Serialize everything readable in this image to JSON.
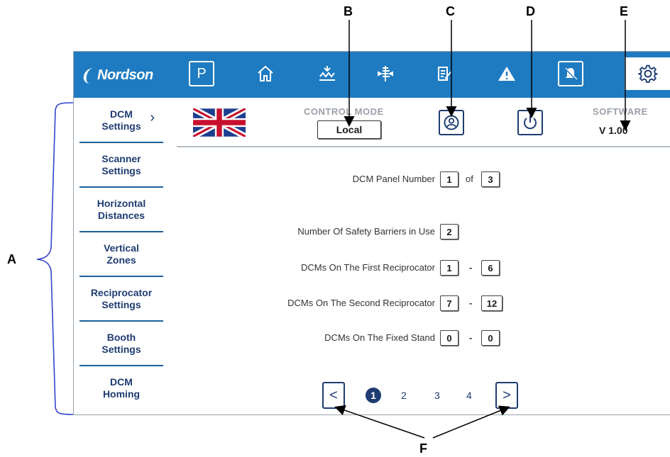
{
  "callouts": {
    "a": "A",
    "b": "B",
    "c": "C",
    "d": "D",
    "e": "E",
    "f": "F"
  },
  "topbar": {
    "brand": "Nordson",
    "buttons": [
      {
        "name": "parking-icon",
        "label": "P"
      },
      {
        "name": "home-icon"
      },
      {
        "name": "spray-icon"
      },
      {
        "name": "reciprocator-icon"
      },
      {
        "name": "edit-log-icon"
      },
      {
        "name": "warning-icon"
      },
      {
        "name": "bell-muted-icon"
      },
      {
        "name": "gear-icon"
      }
    ],
    "colors": {
      "bar": "#1f7bc1",
      "nav_text": "#1e3c72"
    }
  },
  "sidebar": {
    "items": [
      {
        "line1": "DCM",
        "line2": "Settings",
        "active": true
      },
      {
        "line1": "Scanner",
        "line2": "Settings"
      },
      {
        "line1": "Horizontal",
        "line2": "Distances"
      },
      {
        "line1": "Vertical",
        "line2": "Zones"
      },
      {
        "line1": "Reciprocator",
        "line2": "Settings"
      },
      {
        "line1": "Booth",
        "line2": "Settings"
      },
      {
        "line1": "DCM",
        "line2": "Homing"
      }
    ]
  },
  "header": {
    "language_flag": "uk-flag-icon",
    "control_mode_label": "CONTROL MODE",
    "control_mode_value": "Local",
    "software_label": "SOFTWARE",
    "software_version": "V 1.00"
  },
  "form": {
    "panel_label": "DCM Panel Number",
    "panel_value": "1",
    "panel_of": "of",
    "panel_total": "3",
    "barriers_label": "Number Of Safety Barriers in Use",
    "barriers_value": "2",
    "first_recip_label": "DCMs On The First Reciprocator",
    "first_recip_from": "1",
    "first_recip_to": "6",
    "second_recip_label": "DCMs On The Second Reciprocator",
    "second_recip_from": "7",
    "second_recip_to": "12",
    "fixed_stand_label": "DCMs On The Fixed Stand",
    "fixed_stand_from": "0",
    "fixed_stand_to": "0",
    "range_sep": "-"
  },
  "pager": {
    "prev": "<",
    "next": ">",
    "pages": [
      "1",
      "2",
      "3",
      "4"
    ],
    "current": "1"
  }
}
